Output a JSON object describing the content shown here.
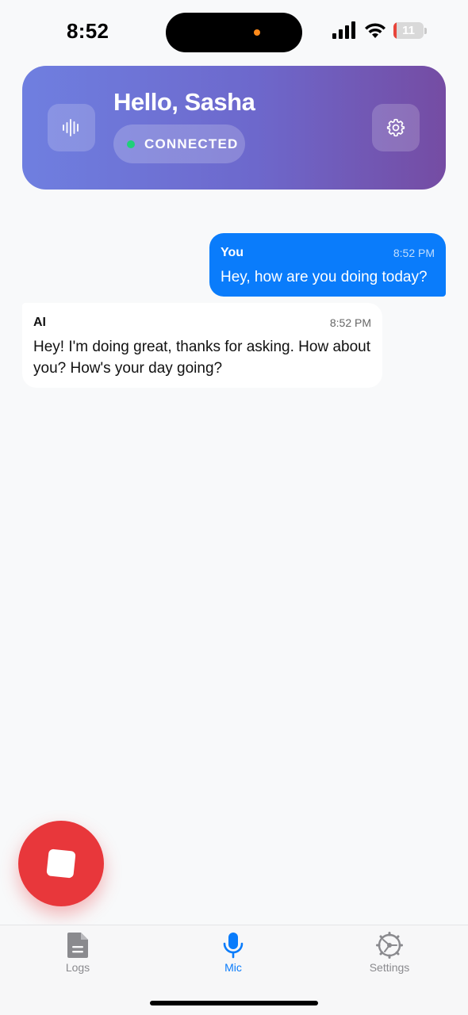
{
  "status_bar": {
    "time": "8:52",
    "battery_level": "11",
    "icons": [
      "signal-icon",
      "wifi-icon",
      "battery-icon"
    ]
  },
  "header": {
    "greeting": "Hello, Sasha",
    "connection_status": "CONNECTED",
    "left_icon": "waveform-icon",
    "right_icon": "gear-icon",
    "gradient_start": "#6f7fe0",
    "gradient_end": "#754ca3",
    "status_color": "#1fd07a"
  },
  "messages": [
    {
      "sender": "You",
      "time": "8:52 PM",
      "text": "Hey, how are you doing today?"
    },
    {
      "sender": "AI",
      "time": "8:52 PM",
      "text": "Hey! I'm doing great, thanks for asking. How about you? How's your day going?"
    }
  ],
  "controls": {
    "stop_button_icon": "stop-icon",
    "stop_button_color": "#e8373b"
  },
  "tabs": [
    {
      "label": "Logs",
      "icon": "document-icon",
      "active": false
    },
    {
      "label": "Mic",
      "icon": "mic-icon",
      "active": true
    },
    {
      "label": "Settings",
      "icon": "settings-icon",
      "active": false
    }
  ],
  "colors": {
    "accent": "#0a7cfb",
    "background": "#f8f9fa"
  }
}
